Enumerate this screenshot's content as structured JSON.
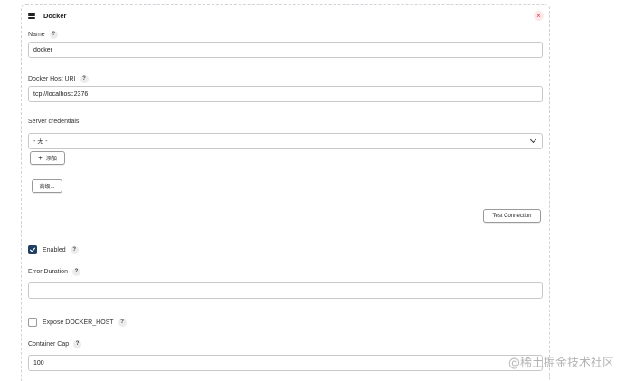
{
  "card": {
    "title": "Docker",
    "menu_icon": "hamburger-icon",
    "close_icon": "close-icon",
    "close_symbol": "×",
    "help_symbol": "?"
  },
  "fields": {
    "name": {
      "label": "Name",
      "value": "docker"
    },
    "docker_host_uri": {
      "label": "Docker Host URI",
      "value": "tcp://localhost:2376"
    },
    "server_credentials": {
      "label": "Server credentials",
      "selected": "- 无 -"
    },
    "enabled": {
      "label": "Enabled",
      "checked": true
    },
    "error_duration": {
      "label": "Error Duration",
      "value": ""
    },
    "expose_docker_host": {
      "label": "Expose DOCKER_HOST",
      "checked": false
    },
    "container_cap": {
      "label": "Container Cap",
      "value": "100"
    }
  },
  "buttons": {
    "add_symbol": "+",
    "add_label": "添加",
    "advanced_label": "高级...",
    "test_connection_label": "Test Connection"
  },
  "watermark": "@稀土掘金技术社区",
  "colors": {
    "checkbox_on": "#1f3f63",
    "close_bg": "#fde8ea",
    "close_fg": "#d43b4b"
  }
}
